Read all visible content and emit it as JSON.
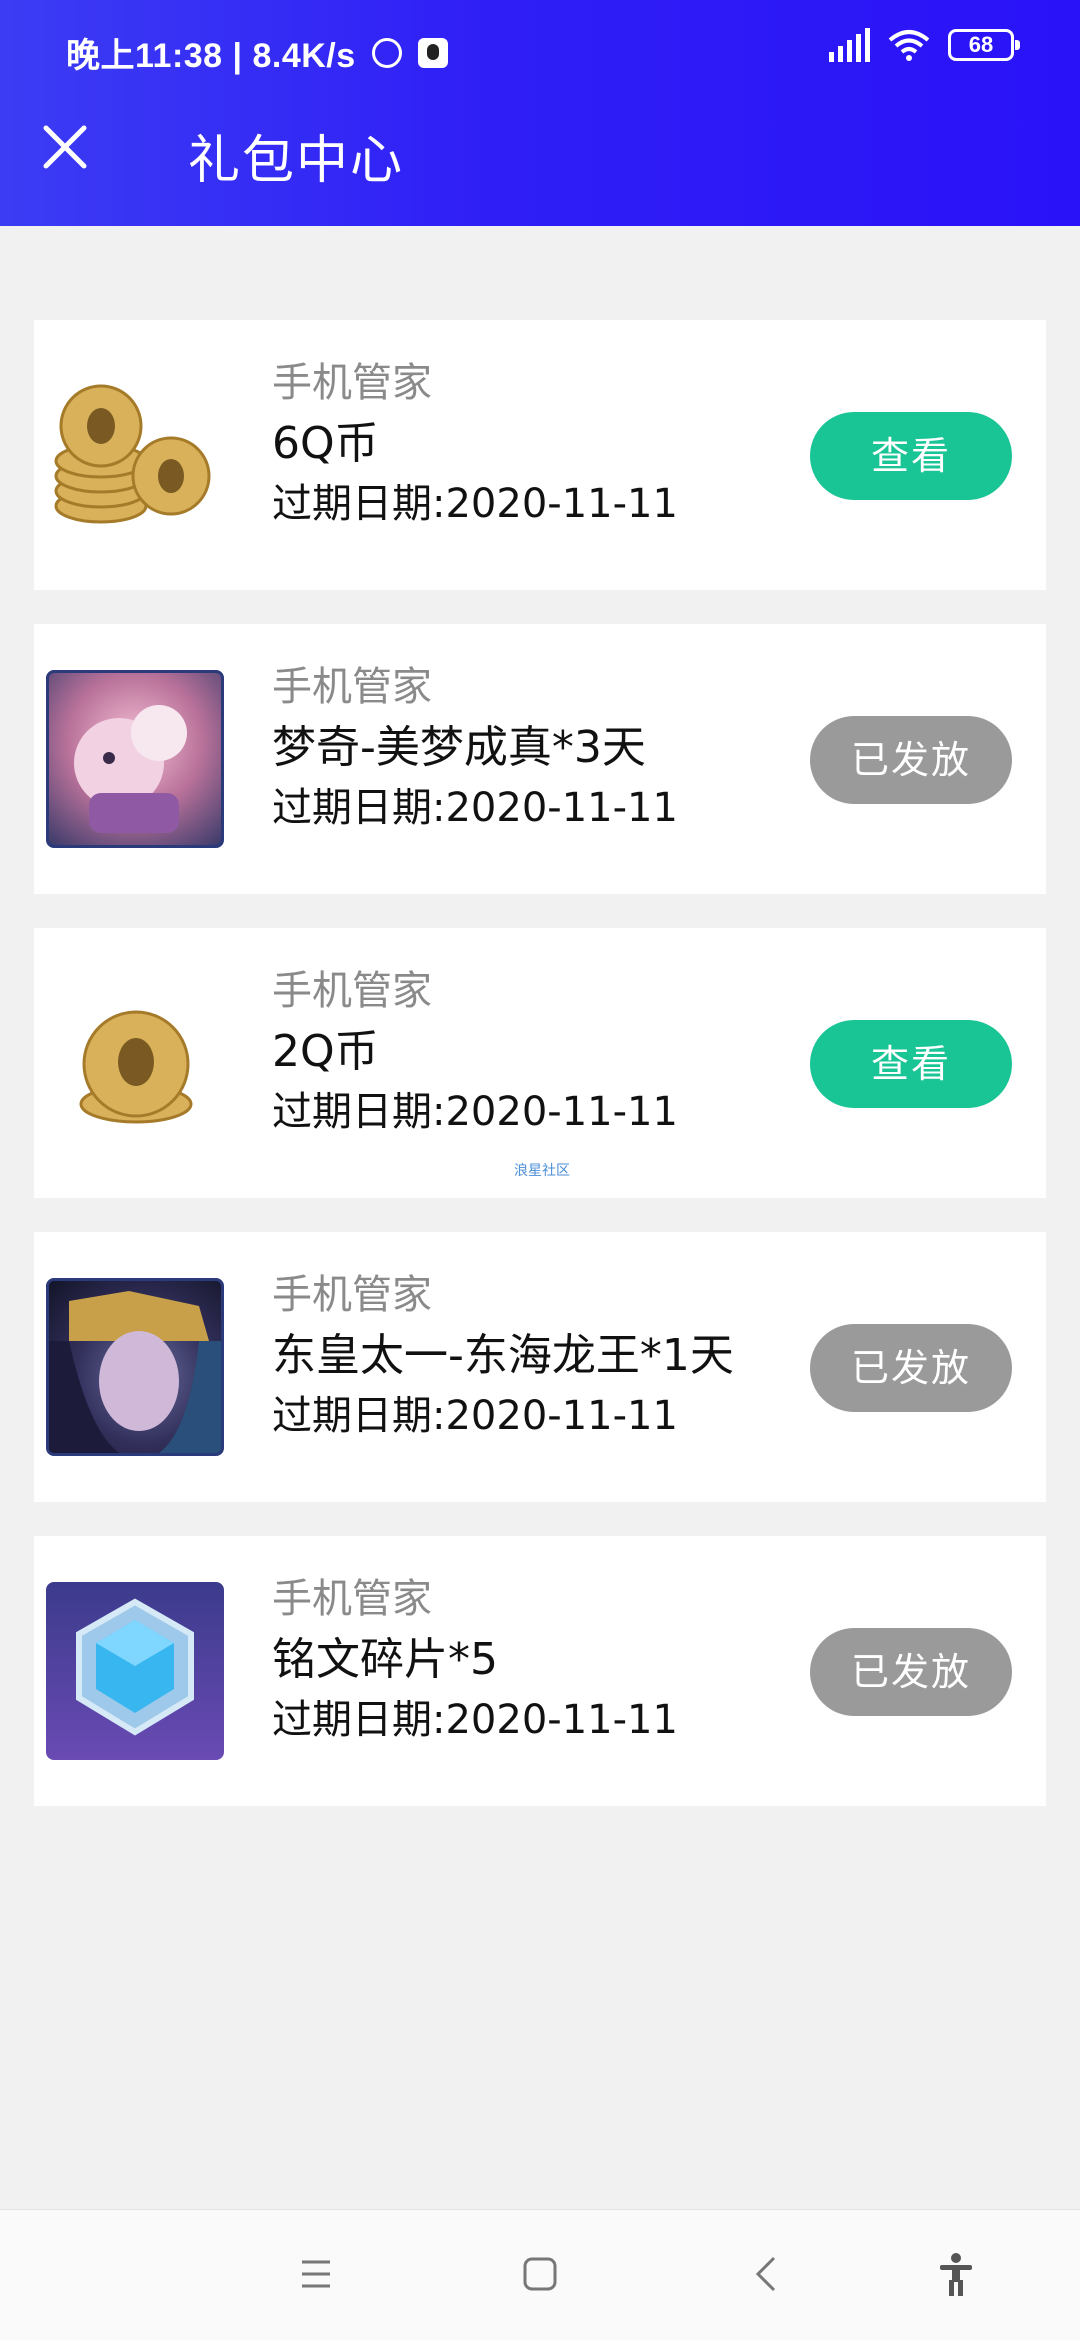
{
  "status_bar": {
    "time_text": "晚上11:38 | 8.4K/s",
    "battery": "68",
    "icons": [
      "alarm-icon",
      "qq-icon",
      "signal-icon",
      "wifi-icon",
      "battery-icon"
    ]
  },
  "header": {
    "title": "礼包中心",
    "close_icon": "close-icon",
    "gradient": [
      "#3c3cf4",
      "#2a12f8"
    ]
  },
  "gifts": [
    {
      "image": "coin-stack-icon",
      "brand": "手机管家",
      "name": "6Q币",
      "expiry": "过期日期:2020-11-11",
      "action": "查看",
      "action_state": "view"
    },
    {
      "image": "hero-skin-icon",
      "brand": "手机管家",
      "name": "梦奇-美梦成真*3天",
      "expiry": "过期日期:2020-11-11",
      "action": "已发放",
      "action_state": "sent"
    },
    {
      "image": "coin-icon",
      "brand": "手机管家",
      "name": "2Q币",
      "expiry": "过期日期:2020-11-11",
      "action": "查看",
      "action_state": "view"
    },
    {
      "image": "hero-skin-icon",
      "brand": "手机管家",
      "name": "东皇太一-东海龙王*1天",
      "expiry": "过期日期:2020-11-11",
      "action": "已发放",
      "action_state": "sent"
    },
    {
      "image": "gem-icon",
      "brand": "手机管家",
      "name": "铭文碎片*5",
      "expiry": "过期日期:2020-11-11",
      "action": "已发放",
      "action_state": "sent"
    }
  ],
  "watermark": "浪星社区",
  "colors": {
    "view": "#19c495",
    "sent": "#9a9a9a",
    "background": "#f1f1f1"
  },
  "navbar": [
    "menu-icon",
    "home-icon",
    "back-icon",
    "accessibility-icon"
  ]
}
